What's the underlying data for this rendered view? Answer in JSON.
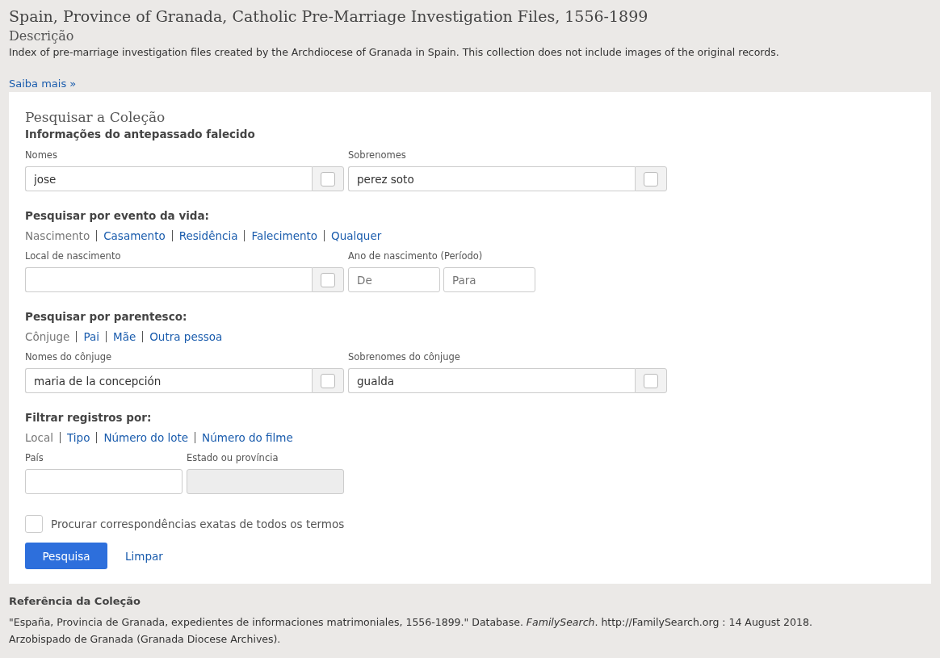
{
  "title": "Spain, Province of Granada, Catholic Pre-Marriage Investigation Files, 1556-1899",
  "description_heading": "Descrição",
  "description": "Index of pre-marriage investigation files created by the Archdiocese of Granada in Spain. This collection does not include images of the original records.",
  "learn_more": "Saiba mais »",
  "search": {
    "title": "Pesquisar a Coleção",
    "ancestor_heading": "Informações do antepassado falecido",
    "ancestor_fields": [
      {
        "label": "Nomes",
        "value": "jose",
        "exact": false
      },
      {
        "label": "Sobrenomes",
        "value": "perez soto",
        "exact": false
      }
    ],
    "life_event": {
      "heading": "Pesquisar por evento da vida:",
      "tabs": [
        {
          "label": "Nascimento",
          "selected": true
        },
        {
          "label": "Casamento",
          "selected": false
        },
        {
          "label": "Residência",
          "selected": false
        },
        {
          "label": "Falecimento",
          "selected": false
        },
        {
          "label": "Qualquer",
          "selected": false
        }
      ],
      "place_field": {
        "label": "Local de nascimento",
        "exact": false
      },
      "year_range": {
        "label": "Ano de nascimento (Período)",
        "from_placeholder": "De",
        "to_placeholder": "Para"
      }
    },
    "relationship": {
      "heading": "Pesquisar por parentesco:",
      "tabs": [
        {
          "label": "Cônjuge",
          "selected": true
        },
        {
          "label": "Pai",
          "selected": false
        },
        {
          "label": "Mãe",
          "selected": false
        },
        {
          "label": "Outra pessoa",
          "selected": false
        }
      ],
      "fields": [
        {
          "label": "Nomes do cônjuge",
          "value": "maria de la concepción",
          "exact": false
        },
        {
          "label": "Sobrenomes do cônjuge",
          "value": "gualda",
          "exact": false
        }
      ]
    },
    "filter": {
      "heading": "Filtrar registros por:",
      "tabs": [
        {
          "label": "Local",
          "selected": true
        },
        {
          "label": "Tipo",
          "selected": false
        },
        {
          "label": "Número do lote",
          "selected": false
        },
        {
          "label": "Número do filme",
          "selected": false
        }
      ],
      "country": {
        "label": "País",
        "disabled": false
      },
      "state": {
        "label": "Estado ou província",
        "disabled": true
      }
    },
    "exact_match": {
      "label": "Procurar correspondências exatas de todos os termos",
      "checked": false
    },
    "search_button": "Pesquisa",
    "clear_link": "Limpar"
  },
  "citation": {
    "heading": "Referência da Coleção",
    "text": "\"España, Provincia de Granada, expedientes de informaciones matrimoniales, 1556-1899.\" Database. *FamilySearch*. http://FamilySearch.org : 14 August 2018.",
    "source": "Arzobispado de Granada (Granada Diocese Archives)."
  }
}
